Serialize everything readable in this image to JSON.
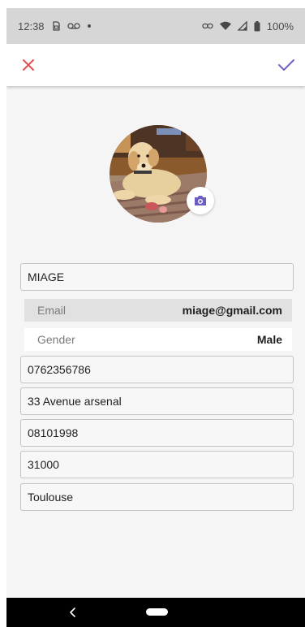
{
  "status_bar": {
    "time": "12:38",
    "battery": "100%",
    "icons": [
      "sim-icon",
      "voicemail-icon",
      "dot-icon",
      "link-icon",
      "wifi-icon",
      "signal-icon",
      "battery-icon"
    ]
  },
  "app_bar": {
    "close_icon": "close-icon",
    "confirm_icon": "check-icon",
    "close_color": "#e05252",
    "confirm_color": "#6f63c8"
  },
  "profile": {
    "camera_icon": "camera-icon",
    "camera_color": "#6a5fc1"
  },
  "form": {
    "name": "MIAGE",
    "email_label": "Email",
    "email_value": "miage@gmail.com",
    "gender_label": "Gender",
    "gender_value": "Male",
    "phone": "0762356786",
    "address": "33 Avenue arsenal",
    "birthdate": "08101998",
    "postal_code": "31000",
    "city": "Toulouse"
  },
  "nav_bar": {
    "back_icon": "back-icon",
    "home_icon": "home-pill-icon"
  }
}
